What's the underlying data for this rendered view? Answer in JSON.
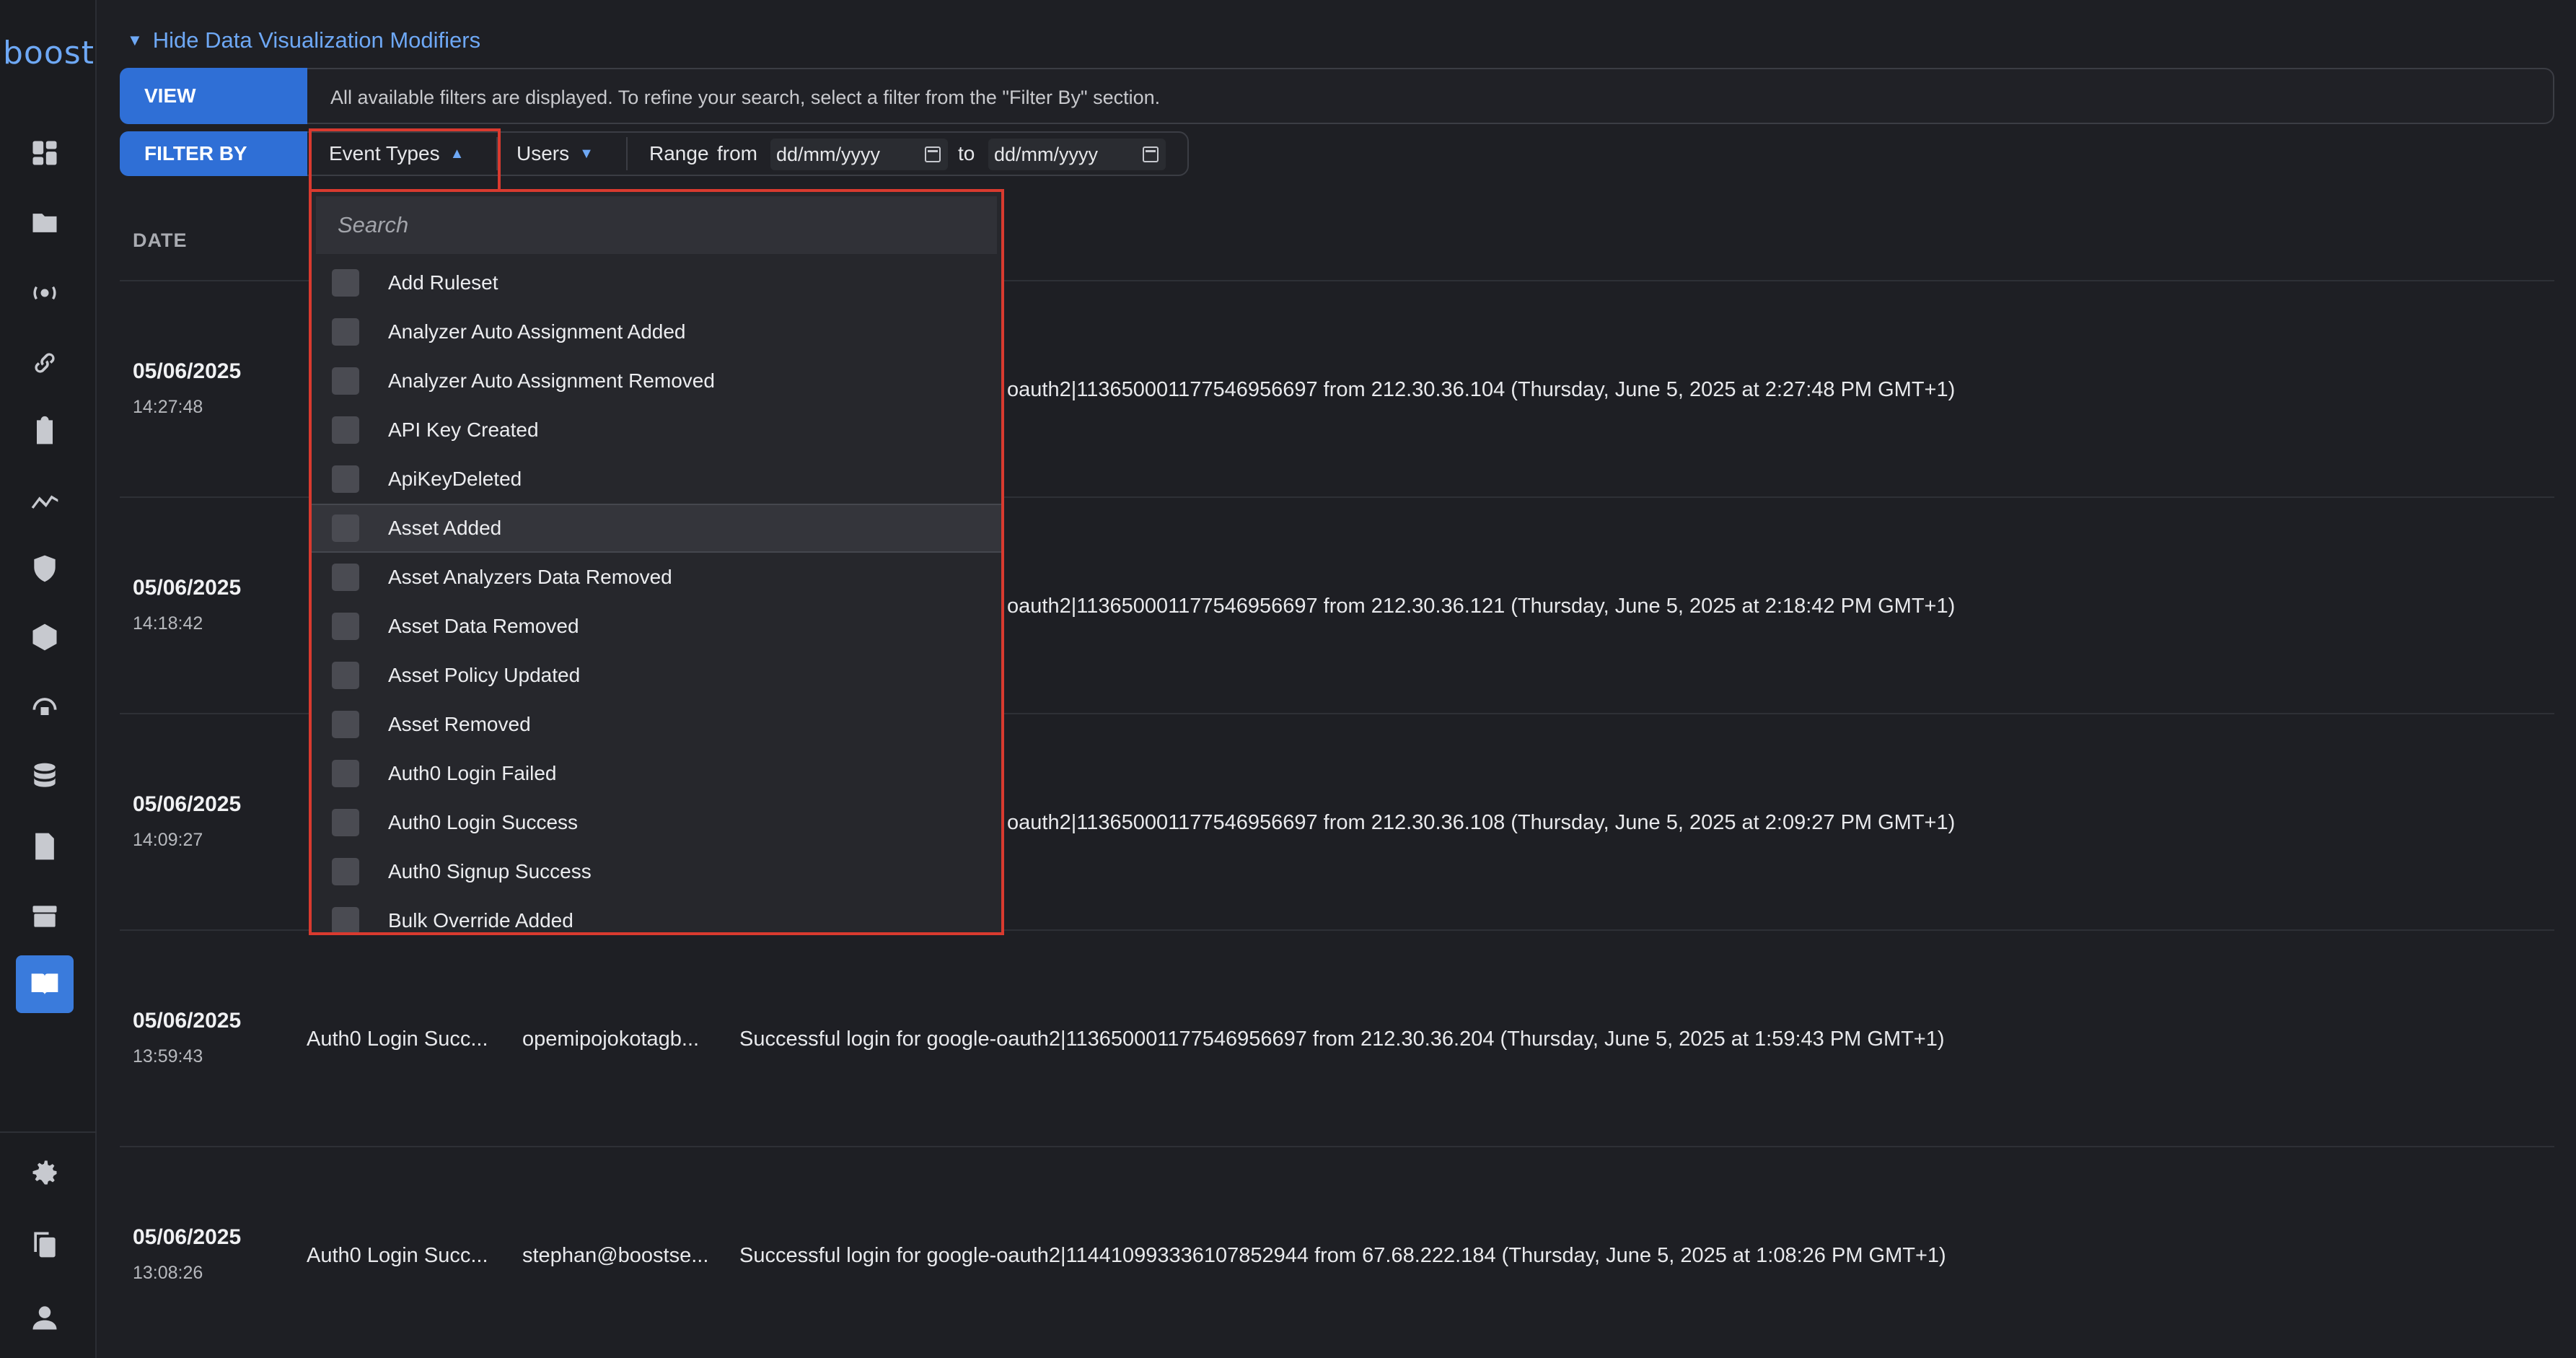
{
  "sidebar": {
    "logo": "boost",
    "icons": [
      "dashboard-icon",
      "folder-icon",
      "broadcast-icon",
      "link-icon",
      "clipboard-icon",
      "trend-icon",
      "shield-alert-icon",
      "package-icon",
      "radar-icon",
      "database-icon",
      "file-check-icon",
      "archive-icon",
      "book-icon"
    ],
    "bottom_icons": [
      "gear-icon",
      "copy-icon",
      "user-icon"
    ]
  },
  "toggle": {
    "label": "Hide Data Visualization Modifiers"
  },
  "view": {
    "label": "VIEW",
    "text": "All available filters are displayed. To refine your search, select a filter from the \"Filter By\" section."
  },
  "filter": {
    "label": "FILTER BY",
    "event_types": "Event Types",
    "users": "Users",
    "range": "Range",
    "from": "from",
    "to": "to",
    "from_placeholder": "dd/mm/yyyy",
    "to_placeholder": "dd/mm/yyyy"
  },
  "table": {
    "date_header": "DATE",
    "rows": [
      {
        "date": "05/06/2025",
        "time": "14:27:48",
        "event": "",
        "user": "",
        "desc": "oauth2|113650001177546956697 from 212.30.36.104 (Thursday, June 5, 2025 at 2:27:48 PM GMT+1)"
      },
      {
        "date": "05/06/2025",
        "time": "14:18:42",
        "event": "",
        "user": "",
        "desc": "oauth2|113650001177546956697 from 212.30.36.121 (Thursday, June 5, 2025 at 2:18:42 PM GMT+1)"
      },
      {
        "date": "05/06/2025",
        "time": "14:09:27",
        "event": "",
        "user": "",
        "desc": "oauth2|113650001177546956697 from 212.30.36.108 (Thursday, June 5, 2025 at 2:09:27 PM GMT+1)"
      },
      {
        "date": "05/06/2025",
        "time": "13:59:43",
        "event": "Auth0 Login Succ...",
        "user": "opemipojokotagb...",
        "desc": "Successful login for google-oauth2|113650001177546956697 from 212.30.36.204 (Thursday, June 5, 2025 at 1:59:43 PM GMT+1)"
      },
      {
        "date": "05/06/2025",
        "time": "13:08:26",
        "event": "Auth0 Login Succ...",
        "user": "stephan@boostse...",
        "desc": "Successful login for google-oauth2|114410993336107852944 from 67.68.222.184 (Thursday, June 5, 2025 at 1:08:26 PM GMT+1)"
      }
    ]
  },
  "dropdown": {
    "search_placeholder": "Search",
    "items": [
      "Add Ruleset",
      "Analyzer Auto Assignment Added",
      "Analyzer Auto Assignment Removed",
      "API Key Created",
      "ApiKeyDeleted",
      "Asset Added",
      "Asset Analyzers Data Removed",
      "Asset Data Removed",
      "Asset Policy Updated",
      "Asset Removed",
      "Auth0 Login Failed",
      "Auth0 Login Success",
      "Auth0 Signup Success",
      "Bulk Override Added"
    ],
    "hovered_index": 5
  }
}
